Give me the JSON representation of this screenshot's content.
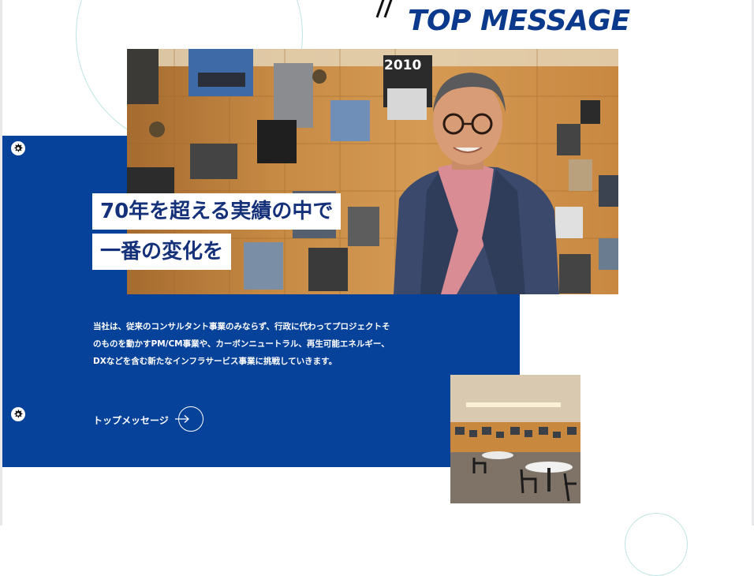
{
  "section": {
    "heading": "TOP MESSAGE"
  },
  "hero": {
    "headline_line1": "70年を超える実績の中で",
    "headline_line2": "一番の変化を",
    "wall_year": "2010"
  },
  "message": {
    "body": "当社は、従来のコンサルタント事業のみならず、行政に代わってプロジェクトそのものを動かすPM/CM事業や、カーボンニュートラル、再生可能エネルギー、DXなどを含む新たなインフラサービス事業に挑戦していきます。",
    "link_label": "トップメッセージ"
  },
  "colors": {
    "brand_blue": "#06429a",
    "heading_blue": "#0b3a8c",
    "accent_teal": "#bfe6e3"
  },
  "icons": [
    "gear-icon",
    "arrow-right-icon"
  ]
}
